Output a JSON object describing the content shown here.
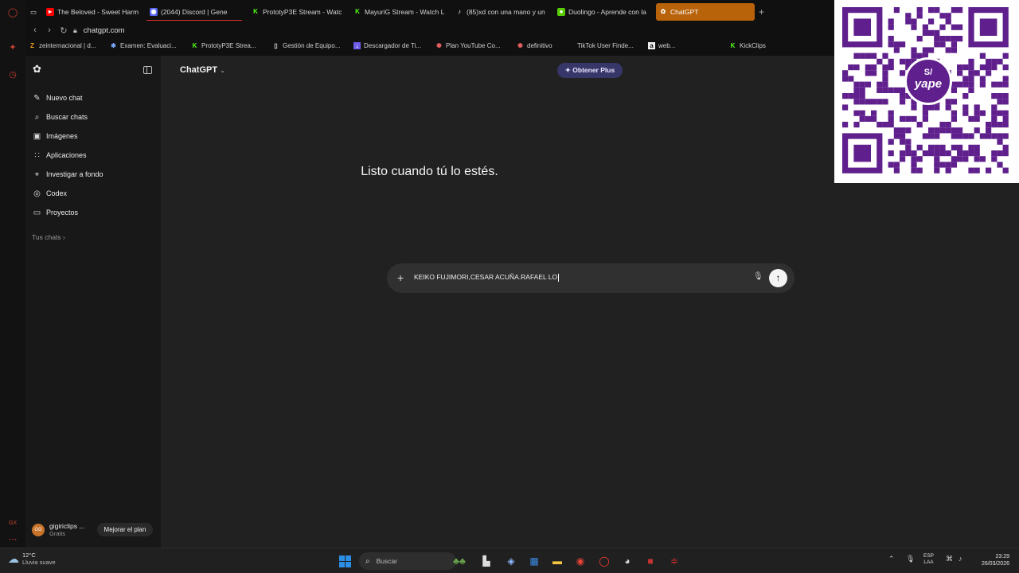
{
  "browser": {
    "tabs": [
      {
        "title": "The Beloved - Sweet Harm",
        "icon": "youtube-icon",
        "color": "#ff0000"
      },
      {
        "title": "(2044) Discord | Gene",
        "icon": "discord-icon",
        "color": "#5865f2"
      },
      {
        "title": "PrototyP3E Stream - Watc",
        "icon": "kick-icon",
        "color": "#53fc18"
      },
      {
        "title": "MayuriG Stream - Watch L",
        "icon": "kick-icon",
        "color": "#53fc18"
      },
      {
        "title": "(85)xd con una mano y un",
        "icon": "tiktok-icon",
        "color": "#ffffff"
      },
      {
        "title": "Duolingo - Aprende con la",
        "icon": "duolingo-icon",
        "color": "#58cc02"
      },
      {
        "title": "ChatGPT",
        "icon": "chatgpt-icon",
        "color": "#ffffff",
        "active": true
      }
    ],
    "new_tab": "+",
    "url": "chatgpt.com",
    "bookmarks": [
      {
        "label": "zeinternacional | d...",
        "icon": "z-icon"
      },
      {
        "label": "Examen: Evaluaci...",
        "icon": "star-icon"
      },
      {
        "label": "PrototyP3E Strea...",
        "icon": "kick-icon"
      },
      {
        "label": "Gestión de Equipo...",
        "icon": "page-icon"
      },
      {
        "label": "Descargador de Ti...",
        "icon": "download-icon"
      },
      {
        "label": "Plan YouTube Co...",
        "icon": "gear-icon"
      },
      {
        "label": "definitivo",
        "icon": "gear-icon"
      },
      {
        "label": "TikTok User Finde...",
        "icon": "tiktok-icon"
      },
      {
        "label": "web...",
        "icon": "a-icon"
      },
      {
        "label": "KickClips",
        "icon": "kick-icon"
      }
    ]
  },
  "sidebar": {
    "items": [
      {
        "label": "Nuevo chat",
        "icon": "edit-icon"
      },
      {
        "label": "Buscar chats",
        "icon": "search-icon"
      },
      {
        "label": "Imágenes",
        "icon": "image-icon"
      },
      {
        "label": "Aplicaciones",
        "icon": "grid-icon"
      },
      {
        "label": "Investigar a fondo",
        "icon": "telescope-icon"
      },
      {
        "label": "Codex",
        "icon": "codex-icon"
      },
      {
        "label": "Proyectos",
        "icon": "folder-icon"
      }
    ],
    "section_label": "Tus chats",
    "user": {
      "initials": "GG",
      "name": "gigiriclips ...",
      "plan": "Gratis"
    },
    "upgrade_label": "Mejorar el plan"
  },
  "main": {
    "model": "ChatGPT",
    "plus_button": "Obtener Plus",
    "heading": "Listo cuando tú lo estés.",
    "composer_text": "KEIKO FUJIMORI,CESAR ACUÑA.RAFAEL LO"
  },
  "overlay": {
    "qr_badge_symbol": "S/",
    "qr_badge_name": "yape",
    "brand_color": "#5f1f8c"
  },
  "taskbar": {
    "temp": "12°C",
    "condition": "Lluvia suave",
    "search_placeholder": "Buscar",
    "lang_top": "ESP",
    "lang_bottom": "LAA",
    "time": "23:29",
    "date": "26/03/2026"
  },
  "colors": {
    "accent_tab": "#b8620a",
    "plus_bg": "#373669",
    "sidebar_bg": "#181818",
    "main_bg": "#212121"
  }
}
